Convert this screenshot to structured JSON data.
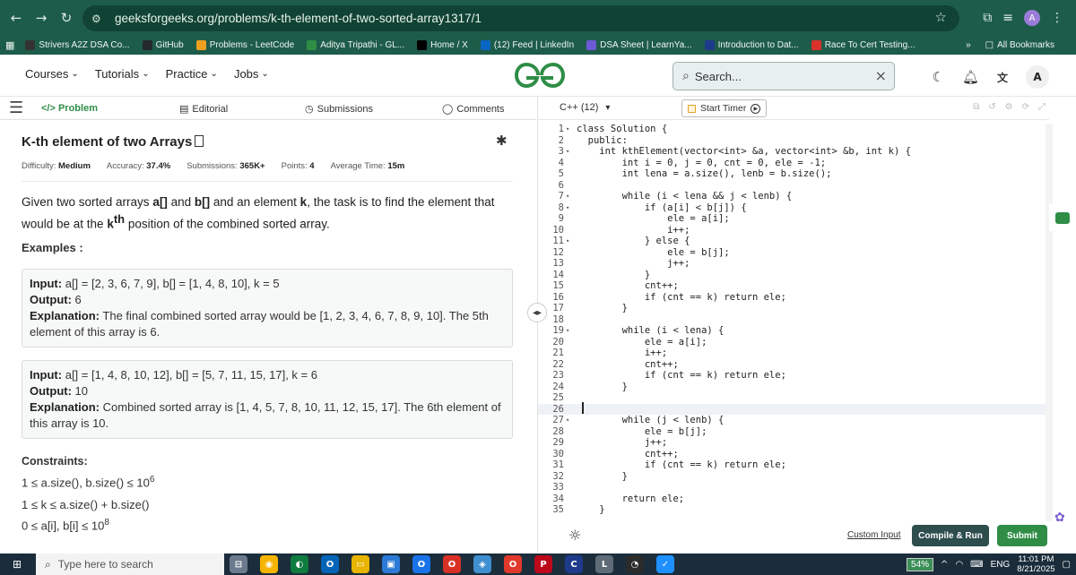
{
  "browser": {
    "url": "geeksforgeeks.org/problems/k-th-element-of-two-sorted-array1317/1",
    "profile_initial": "A",
    "bookmarks": [
      {
        "label": "Strivers A2Z DSA Co...",
        "color": "#333333"
      },
      {
        "label": "GitHub",
        "color": "#24292e"
      },
      {
        "label": "Problems - LeetCode",
        "color": "#f0a020"
      },
      {
        "label": "Aditya Tripathi - GL...",
        "color": "#2f8d46"
      },
      {
        "label": "Home / X",
        "color": "#000000"
      },
      {
        "label": "(12) Feed | LinkedIn",
        "color": "#0a66c2"
      },
      {
        "label": "DSA Sheet | LearnYa...",
        "color": "#6b5bd6"
      },
      {
        "label": "Introduction to Dat...",
        "color": "#1e3a8a"
      },
      {
        "label": "Race To Cert Testing...",
        "color": "#d9322b"
      }
    ],
    "bookmarks_more": "»",
    "all_bookmarks": "All Bookmarks"
  },
  "header": {
    "nav": [
      "Courses",
      "Tutorials",
      "Practice",
      "Jobs"
    ],
    "search_placeholder": "Search..."
  },
  "tabs": {
    "problem": "</> Problem",
    "editorial": "Editorial",
    "submissions": "Submissions",
    "comments": "Comments"
  },
  "problem": {
    "title": "K-th element of two Arrays",
    "difficulty_label": "Difficulty:",
    "difficulty": "Medium",
    "accuracy_label": "Accuracy:",
    "accuracy": "37.4%",
    "submissions_label": "Submissions:",
    "submissions": "365K+",
    "points_label": "Points:",
    "points": "4",
    "avg_time_label": "Average Time:",
    "avg_time": "15m",
    "desc_1": "Given two sorted arrays ",
    "desc_a": "a[]",
    "desc_2": " and ",
    "desc_b": "b[]",
    "desc_3": " and an element ",
    "desc_k": "k",
    "desc_4": ", the task is to find the element that would be at the ",
    "desc_kth": "k",
    "desc_th": "th",
    "desc_5": " position of the combined sorted array.",
    "examples_heading": "Examples :",
    "examples": [
      {
        "input_label": "Input:",
        "input": "a[] = [2, 3, 6, 7, 9], b[] = [1, 4, 8, 10], k = 5",
        "output_label": "Output:",
        "output": "6",
        "explanation_label": "Explanation:",
        "explanation": "The final combined sorted array would be [1, 2, 3, 4, 6, 7, 8, 9, 10]. The 5th element of this array is 6."
      },
      {
        "input_label": "Input:",
        "input": "a[] = [1, 4, 8, 10, 12], b[] = [5, 7, 11, 15, 17], k = 6",
        "output_label": "Output:",
        "output": "10",
        "explanation_label": "Explanation:",
        "explanation": "Combined sorted array is [1, 4, 5, 7, 8, 10, 11, 12, 15, 17]. The 6th element of this array is 10."
      }
    ],
    "constraints_heading": "Constraints:",
    "constraint_1": "1 ≤ a.size(), b.size() ≤ 10",
    "constraint_1_sup": "6",
    "constraint_2": "1 ≤ k ≤ a.size() + b.size()",
    "constraint_3": "0 ≤ a[i], b[i] ≤ 10",
    "constraint_3_sup": "8"
  },
  "editor": {
    "language": "C++ (12)",
    "timer_label": "Start Timer",
    "custom_input": "Custom Input",
    "compile_label": "Compile & Run",
    "submit_label": "Submit",
    "current_line": 26,
    "lines": [
      {
        "n": "1",
        "fold": "▾",
        "code": "class Solution {"
      },
      {
        "n": "2",
        "fold": "",
        "code": "  public:"
      },
      {
        "n": "3",
        "fold": "▾",
        "code": "    int kthElement(vector<int> &a, vector<int> &b, int k) {"
      },
      {
        "n": "4",
        "fold": "",
        "code": "        int i = 0, j = 0, cnt = 0, ele = -1;"
      },
      {
        "n": "5",
        "fold": "",
        "code": "        int lena = a.size(), lenb = b.size();"
      },
      {
        "n": "6",
        "fold": "",
        "code": ""
      },
      {
        "n": "7",
        "fold": "▾",
        "code": "        while (i < lena && j < lenb) {"
      },
      {
        "n": "8",
        "fold": "▾",
        "code": "            if (a[i] < b[j]) {"
      },
      {
        "n": "9",
        "fold": "",
        "code": "                ele = a[i];"
      },
      {
        "n": "10",
        "fold": "",
        "code": "                i++;"
      },
      {
        "n": "11",
        "fold": "▾",
        "code": "            } else {"
      },
      {
        "n": "12",
        "fold": "",
        "code": "                ele = b[j];"
      },
      {
        "n": "13",
        "fold": "",
        "code": "                j++;"
      },
      {
        "n": "14",
        "fold": "",
        "code": "            }"
      },
      {
        "n": "15",
        "fold": "",
        "code": "            cnt++;"
      },
      {
        "n": "16",
        "fold": "",
        "code": "            if (cnt == k) return ele;"
      },
      {
        "n": "17",
        "fold": "",
        "code": "        }"
      },
      {
        "n": "18",
        "fold": "",
        "code": ""
      },
      {
        "n": "19",
        "fold": "▾",
        "code": "        while (i < lena) {"
      },
      {
        "n": "20",
        "fold": "",
        "code": "            ele = a[i];"
      },
      {
        "n": "21",
        "fold": "",
        "code": "            i++;"
      },
      {
        "n": "22",
        "fold": "",
        "code": "            cnt++;"
      },
      {
        "n": "23",
        "fold": "",
        "code": "            if (cnt == k) return ele;"
      },
      {
        "n": "24",
        "fold": "",
        "code": "        }"
      },
      {
        "n": "25",
        "fold": "",
        "code": ""
      },
      {
        "n": "26",
        "fold": "",
        "code": ""
      },
      {
        "n": "27",
        "fold": "▾",
        "code": "        while (j < lenb) {"
      },
      {
        "n": "28",
        "fold": "",
        "code": "            ele = b[j];"
      },
      {
        "n": "29",
        "fold": "",
        "code": "            j++;"
      },
      {
        "n": "30",
        "fold": "",
        "code": "            cnt++;"
      },
      {
        "n": "31",
        "fold": "",
        "code": "            if (cnt == k) return ele;"
      },
      {
        "n": "32",
        "fold": "",
        "code": "        }"
      },
      {
        "n": "33",
        "fold": "",
        "code": ""
      },
      {
        "n": "34",
        "fold": "",
        "code": "        return ele;"
      },
      {
        "n": "35",
        "fold": "",
        "code": "    }"
      }
    ]
  },
  "taskbar": {
    "search_placeholder": "Type here to search",
    "battery": "54%",
    "language": "ENG",
    "time": "11:01 PM",
    "date": "8/21/2025"
  }
}
